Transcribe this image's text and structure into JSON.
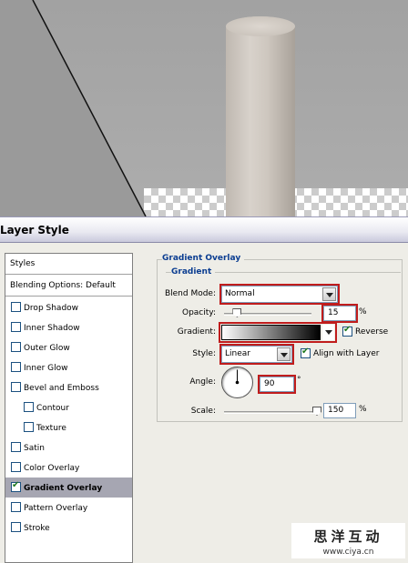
{
  "dialog": {
    "title": "Layer Style"
  },
  "styles": {
    "header": "Styles",
    "blending_options": "Blending Options: Default",
    "items": [
      {
        "label": "Drop Shadow",
        "checked": false,
        "sub": false,
        "active": false
      },
      {
        "label": "Inner Shadow",
        "checked": false,
        "sub": false,
        "active": false
      },
      {
        "label": "Outer Glow",
        "checked": false,
        "sub": false,
        "active": false
      },
      {
        "label": "Inner Glow",
        "checked": false,
        "sub": false,
        "active": false
      },
      {
        "label": "Bevel and Emboss",
        "checked": false,
        "sub": false,
        "active": false
      },
      {
        "label": "Contour",
        "checked": false,
        "sub": true,
        "active": false
      },
      {
        "label": "Texture",
        "checked": false,
        "sub": true,
        "active": false
      },
      {
        "label": "Satin",
        "checked": false,
        "sub": false,
        "active": false
      },
      {
        "label": "Color Overlay",
        "checked": false,
        "sub": false,
        "active": false
      },
      {
        "label": "Gradient Overlay",
        "checked": true,
        "sub": false,
        "active": true
      },
      {
        "label": "Pattern Overlay",
        "checked": false,
        "sub": false,
        "active": false
      },
      {
        "label": "Stroke",
        "checked": false,
        "sub": false,
        "active": false
      }
    ]
  },
  "gradient_overlay": {
    "section_title": "Gradient Overlay",
    "group_title": "Gradient",
    "blend_mode_label": "Blend Mode:",
    "blend_mode_value": "Normal",
    "opacity_label": "Opacity:",
    "opacity_value": "15",
    "opacity_unit": "%",
    "opacity_fraction": 0.15,
    "gradient_label": "Gradient:",
    "reverse_label": "Reverse",
    "reverse_checked": true,
    "style_label": "Style:",
    "style_value": "Linear",
    "align_label": "Align with Layer",
    "align_checked": true,
    "angle_label": "Angle:",
    "angle_value": "90",
    "angle_unit": "°",
    "scale_label": "Scale:",
    "scale_value": "150",
    "scale_unit": "%",
    "scale_fraction": 1.0
  },
  "watermark": {
    "text_cn": "思洋互动",
    "url": "www.ciya.cn"
  },
  "colors": {
    "highlight": "#c01c1c",
    "legend_blue": "#0b3d91",
    "active_row": "#a6a6b2"
  }
}
